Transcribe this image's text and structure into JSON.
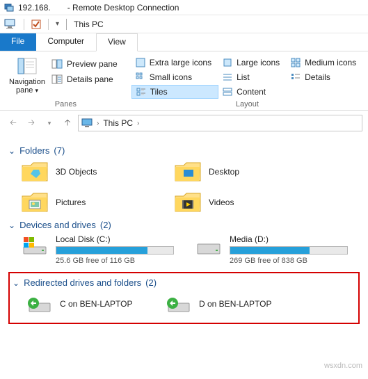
{
  "window": {
    "ip": "192.168.",
    "title_suffix": "- Remote Desktop Connection"
  },
  "qat": {
    "location": "This PC"
  },
  "tabs": {
    "file": "File",
    "computer": "Computer",
    "view": "View"
  },
  "ribbon": {
    "nav_pane": "Navigation pane",
    "preview_pane": "Preview pane",
    "details_pane": "Details pane",
    "panes_group": "Panes",
    "layout_group": "Layout",
    "layouts": {
      "xl": "Extra large icons",
      "lg": "Large icons",
      "md": "Medium icons",
      "sm": "Small icons",
      "list": "List",
      "details": "Details",
      "tiles": "Tiles",
      "content": "Content"
    }
  },
  "breadcrumb": {
    "root": "This PC"
  },
  "sections": {
    "folders": {
      "title": "Folders",
      "count": "(7)"
    },
    "devices": {
      "title": "Devices and drives",
      "count": "(2)"
    },
    "redirected": {
      "title": "Redirected drives and folders",
      "count": "(2)"
    }
  },
  "folders": {
    "obj3d": "3D Objects",
    "desktop": "Desktop",
    "pictures": "Pictures",
    "videos": "Videos"
  },
  "drives": {
    "c": {
      "name": "Local Disk (C:)",
      "free": "25.6 GB free of 116 GB",
      "fill_pct": 78
    },
    "d": {
      "name": "Media (D:)",
      "free": "269 GB free of 838 GB",
      "fill_pct": 68
    }
  },
  "redirected": {
    "c": "C on BEN-LAPTOP",
    "d": "D on BEN-LAPTOP"
  },
  "watermark": "wsxdn.com"
}
